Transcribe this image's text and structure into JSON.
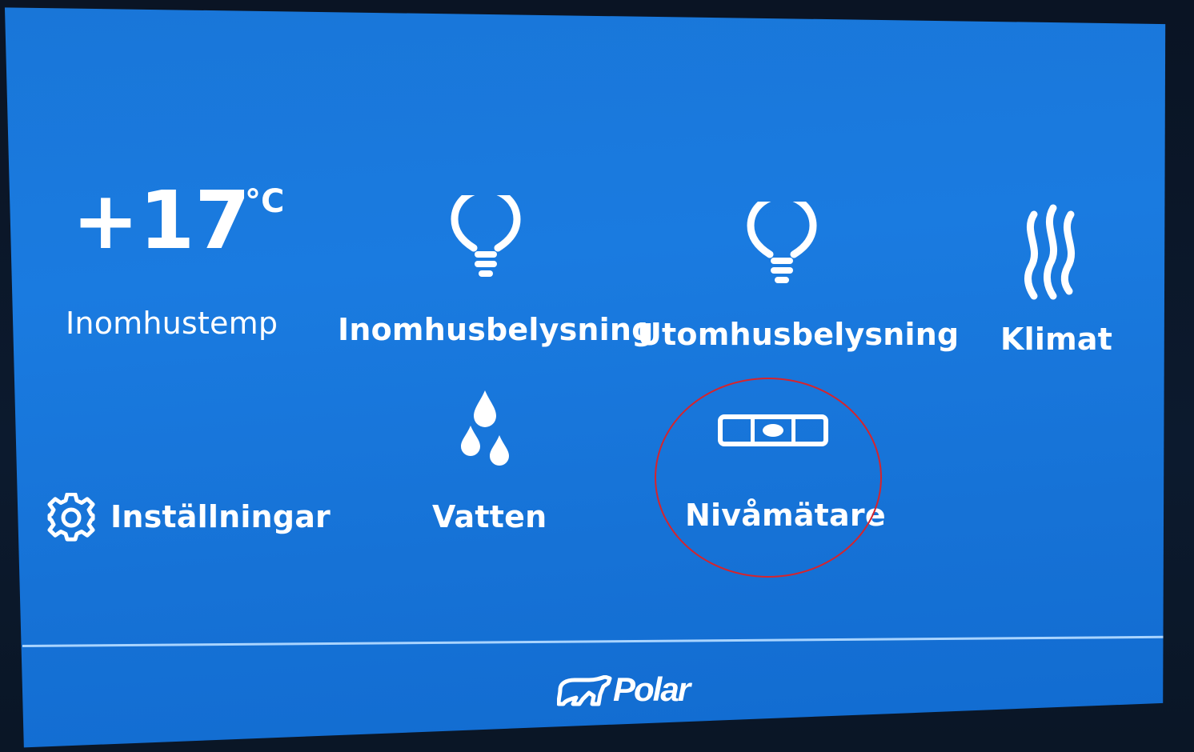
{
  "tiles": {
    "indoor_temp": {
      "value": "+17",
      "unit": "°C",
      "label": "Inomhustemp"
    },
    "indoor_lighting": {
      "label": "Inomhusbelysning",
      "icon": "lightbulb-icon"
    },
    "outdoor_lighting": {
      "label": "Utomhusbelysning",
      "icon": "lightbulb-icon"
    },
    "climate": {
      "label": "Klimat",
      "icon": "heat-waves-icon"
    },
    "settings": {
      "label": "Inställningar",
      "icon": "gear-icon"
    },
    "water": {
      "label": "Vatten",
      "icon": "water-drops-icon"
    },
    "level_meter": {
      "label": "Nivåmätare",
      "icon": "spirit-level-icon"
    }
  },
  "footer": {
    "brand": "Polar",
    "logo_icon": "polar-bear-logo"
  },
  "colors": {
    "screen_background": "#1976d8",
    "text": "#ffffff",
    "divider": "#a9d4ff",
    "annotation": "#d6242c"
  }
}
